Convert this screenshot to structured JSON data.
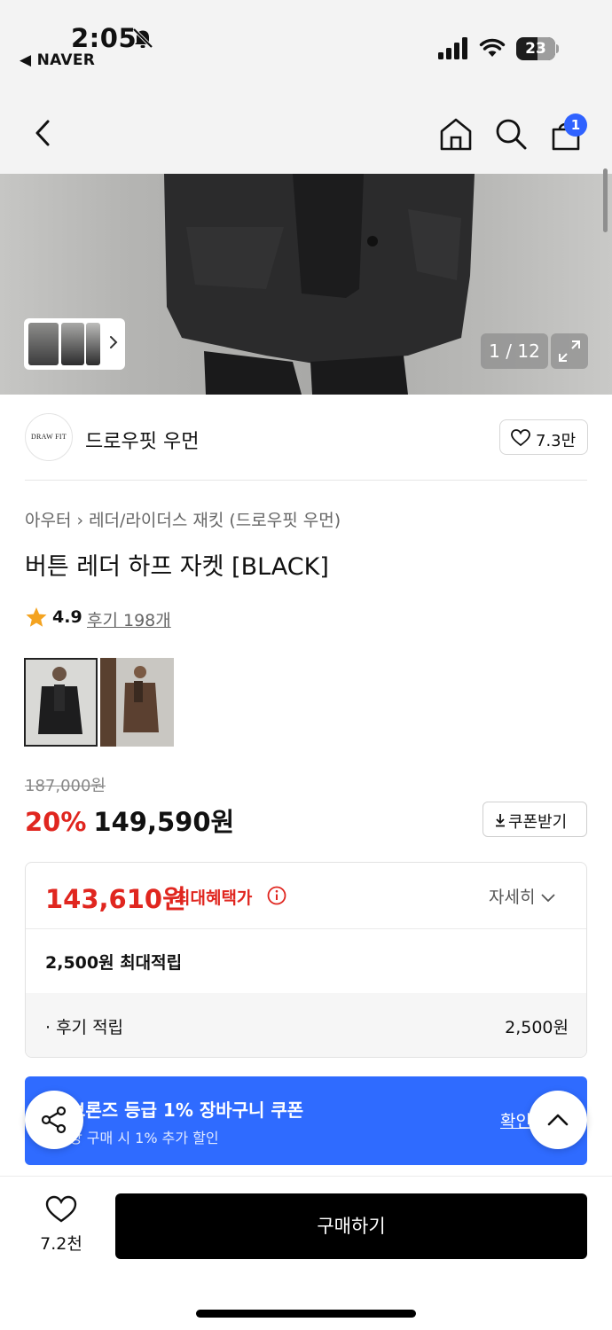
{
  "status_bar": {
    "time": "2:05",
    "back_app": "◀ NAVER",
    "battery": "23"
  },
  "nav": {
    "cart_count": "1"
  },
  "gallery": {
    "counter": "1 / 12"
  },
  "store": {
    "logo_text": "DRAW FIT",
    "name": "드로우핏 우먼",
    "likes": "7.3만"
  },
  "product": {
    "breadcrumb": [
      "아우터",
      "레더/라이더스 재킷 (드로우핏 우먼)"
    ],
    "title": "버튼 레더 하프 자켓 [BLACK]",
    "rating": "4.9",
    "reviews": "후기 198개",
    "original_price": "187,000원",
    "discount_pct": "20%",
    "sale_price": "149,590원",
    "coupon_button": "쿠폰받기"
  },
  "benefits": {
    "max_price": "143,610원",
    "max_label": "최대혜택가",
    "detail_link": "자세히",
    "reward_total": "2,500원 최대적립",
    "review_reward_label": "· 후기 적립",
    "review_reward_value": "2,500원"
  },
  "promo": {
    "title": "브론즈 등급 1% 장바구니 쿠폰",
    "subtitle": "상 구매 시 1% 추가 할인",
    "link": "확인"
  },
  "bottom": {
    "wish_count": "7.2천",
    "buy_label": "구매하기"
  },
  "colors": {
    "accent_red": "#e0261f",
    "accent_blue": "#2f6bff",
    "buy_black": "#000000"
  }
}
